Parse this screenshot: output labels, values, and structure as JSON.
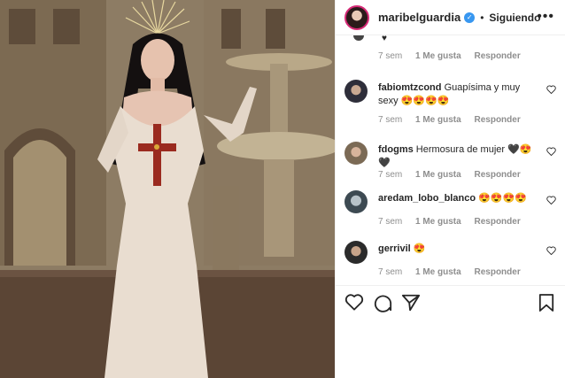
{
  "header": {
    "username": "maribelguardia",
    "separator": "•",
    "follow_status": "Siguiendo",
    "more_label": "•••"
  },
  "partial_comment": {
    "time": "7 sem",
    "likes": "1 Me gusta",
    "reply": "Responder"
  },
  "comments": [
    {
      "user": "fabiomtzcond",
      "text": "Guapísima y muy sexy 😍😍😍😍",
      "time": "7 sem",
      "likes": "1 Me gusta",
      "reply": "Responder"
    },
    {
      "user": "fdogms",
      "text": "Hermosura de mujer 🖤😍🖤",
      "time": "7 sem",
      "likes": "1 Me gusta",
      "reply": "Responder"
    },
    {
      "user": "aredam_lobo_blanco",
      "text": "😍😍😍😍",
      "time": "7 sem",
      "likes": "1 Me gusta",
      "reply": "Responder"
    },
    {
      "user": "gerrivil",
      "text": "😍",
      "time": "7 sem",
      "likes": "1 Me gusta",
      "reply": "Responder"
    }
  ],
  "icons": [
    "heart-icon",
    "comment-icon",
    "share-icon",
    "bookmark-icon"
  ],
  "colors": {
    "verified": "#3897f0",
    "meta_gray": "#8e8e8e",
    "text": "#262626"
  }
}
